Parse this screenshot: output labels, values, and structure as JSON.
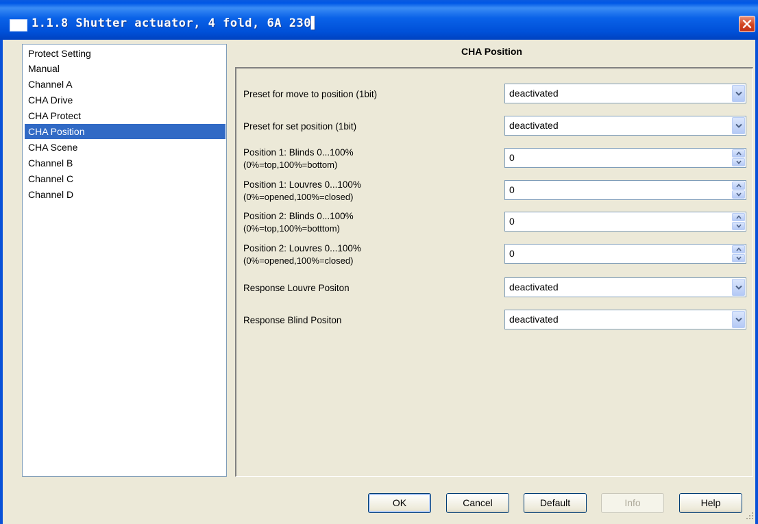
{
  "window": {
    "title": "1.1.8 Shutter actuator, 4 fold, 6A 230▌"
  },
  "tree": {
    "items": [
      {
        "label": "Protect Setting",
        "selected": false
      },
      {
        "label": "Manual",
        "selected": false
      },
      {
        "label": "Channel A",
        "selected": false
      },
      {
        "label": "CHA Drive",
        "selected": false
      },
      {
        "label": "CHA Protect",
        "selected": false
      },
      {
        "label": "CHA Position",
        "selected": true
      },
      {
        "label": "CHA Scene",
        "selected": false
      },
      {
        "label": "Channel B",
        "selected": false
      },
      {
        "label": "Channel C",
        "selected": false
      },
      {
        "label": "Channel D",
        "selected": false
      }
    ]
  },
  "panel": {
    "title": "CHA Position",
    "params": [
      {
        "label": "Preset for move to position (1bit)",
        "type": "dropdown",
        "value": "deactivated"
      },
      {
        "label": "Preset for set position (1bit)",
        "type": "dropdown",
        "value": "deactivated"
      },
      {
        "label": "Position 1: Blinds 0...100%",
        "sublabel": "(0%=top,100%=bottom)",
        "type": "spinner",
        "value": "0"
      },
      {
        "label": "Position 1: Louvres 0...100%",
        "sublabel": "(0%=opened,100%=closed)",
        "type": "spinner",
        "value": "0"
      },
      {
        "label": "Position 2: Blinds 0...100%",
        "sublabel": "(0%=top,100%=botttom)",
        "type": "spinner",
        "value": "0"
      },
      {
        "label": "Position 2: Louvres 0...100%",
        "sublabel": "(0%=opened,100%=closed)",
        "type": "spinner",
        "value": "0"
      },
      {
        "label": "Response Louvre Positon",
        "type": "dropdown",
        "value": "deactivated"
      },
      {
        "label": "Response Blind Positon",
        "type": "dropdown",
        "value": "deactivated"
      }
    ]
  },
  "buttons": {
    "ok": "OK",
    "cancel": "Cancel",
    "default": "Default",
    "info": "Info",
    "help": "Help"
  },
  "colors": {
    "titlebar": "#0a5ae0",
    "selection": "#316ac5",
    "dialog_bg": "#ece9d8"
  }
}
